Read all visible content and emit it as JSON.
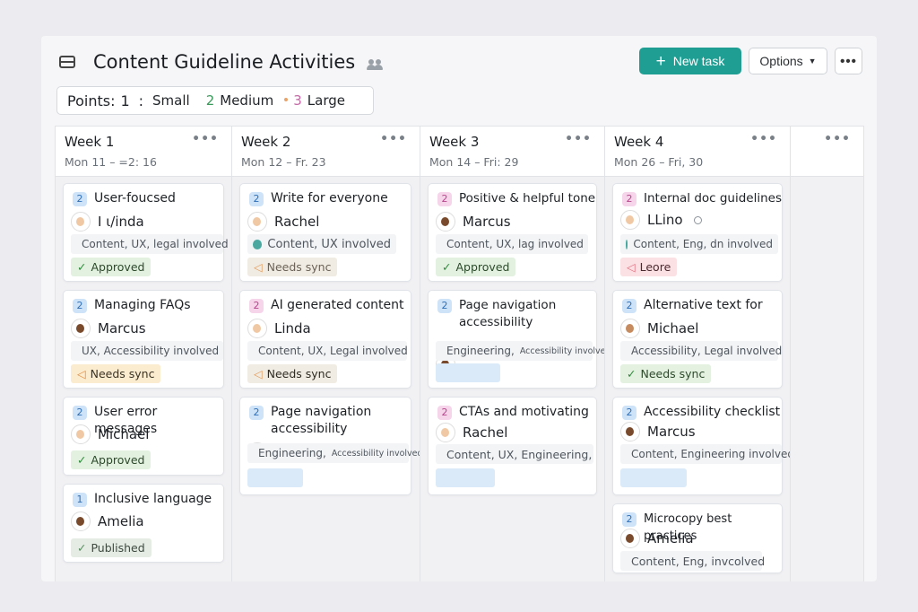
{
  "header": {
    "title": "Content Guideline Activities",
    "new_task_label": "New task",
    "options_label": "Options",
    "more_label": "•••"
  },
  "points": {
    "label": "Points:",
    "small_count": "1",
    "sep": ":",
    "small_label": "Small",
    "medium_count": "2",
    "medium_label": "Medium",
    "large_count": "3",
    "large_label": "Large"
  },
  "colors": {
    "accent": "#1f9e94",
    "medium": "#3a9a5a",
    "large": "#c46aa6"
  },
  "columns": [
    {
      "title": "Week 1",
      "dates": "Mon 11 – =2: 16",
      "more": "•••"
    },
    {
      "title": "Week 2",
      "dates": "Mon 12 –  Fr. 23",
      "more": "•••"
    },
    {
      "title": "Week 3",
      "dates": "Mon 14 – Fri: 29",
      "more": "•••"
    },
    {
      "title": "Week 4",
      "dates": "Mon 26 – Fri, 30",
      "more": "•••"
    },
    {
      "title": "",
      "dates": "",
      "more": "•••"
    }
  ],
  "cards": {
    "w1": [
      {
        "points": "2",
        "title": "User-foucsed",
        "assignee": "I ɩ/inda",
        "involved": "Content, UX, legal involved",
        "tag": "Approved"
      },
      {
        "points": "2",
        "title": "Managing FAQs",
        "assignee": "Marcus",
        "involved": "UX, Accessibility involved",
        "tag": "Needs sync"
      },
      {
        "points": "2",
        "title": "User error messages",
        "assignee": "Michael",
        "tag": "Approved"
      },
      {
        "points": "1",
        "title": "Inclusive language",
        "assignee": "Amelia",
        "tag": "Published"
      }
    ],
    "w2": [
      {
        "points": "2",
        "title": "Write for everyone",
        "assignee": "Rachel",
        "involved": "Content, UX  involved",
        "tag": "Needs sync"
      },
      {
        "points": "2",
        "title": "AI generated content",
        "assignee": "Linda",
        "involved": "Content, UX, Legal involved",
        "tag": "Needs sync"
      },
      {
        "points": "2",
        "title_1": "Page navigation",
        "title_2": "accessibility",
        "involved_a": "Engineering,",
        "involved_b": "Accessibility involved"
      }
    ],
    "w3": [
      {
        "points": "2",
        "title": "Positive & helpful tone",
        "assignee": "Marcus",
        "involved": "Content, UX, lag involved",
        "tag": "Approved"
      },
      {
        "points": "2",
        "title_1": "Page navigation",
        "title_2": "accessibility",
        "involved_a": "Engineering,",
        "involved_b": "Accessibility involved"
      },
      {
        "points": "2",
        "title": "CTAs and motivating",
        "assignee": "Rachel",
        "involved": "Content, UX, Engineering,"
      }
    ],
    "w4": [
      {
        "points": "2",
        "title": "Internal doc guidelines",
        "assignee": "LLino",
        "involved": "Content, Eng, dn involved",
        "tag": "Leore"
      },
      {
        "points": "2",
        "title": "Alternative text for",
        "assignee": "Michael",
        "involved": "Accessibility, Legal involved",
        "tag": "Needs sync"
      },
      {
        "points": "2",
        "title": "Accessibility checklist",
        "assignee": "Marcus",
        "involved": "Content, Engineering involved"
      },
      {
        "points": "2",
        "title": "Microcopy best practices",
        "assignee": "Amelia",
        "involved": "Content, Eng, invcolved"
      }
    ]
  }
}
